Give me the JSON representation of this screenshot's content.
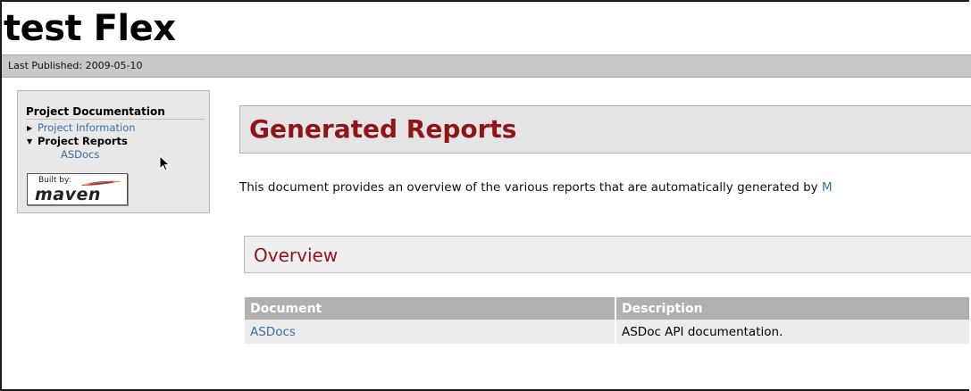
{
  "header": {
    "site_title": "test Flex",
    "last_published": "Last Published: 2009-05-10"
  },
  "sidebar": {
    "heading": "Project Documentation",
    "items": [
      {
        "label": "Project Information",
        "expanded": false
      },
      {
        "label": "Project Reports",
        "expanded": true
      },
      {
        "label": "ASDocs"
      }
    ],
    "badge": {
      "built_by": "Built by:",
      "name": "maven"
    }
  },
  "main": {
    "title": "Generated Reports",
    "intro": "This document provides an overview of the various reports that are automatically generated by",
    "intro_cut_link": "M",
    "section_title": "Overview",
    "table": {
      "headers": [
        "Document",
        "Description"
      ],
      "rows": [
        {
          "document": "ASDocs",
          "description": "ASDoc API documentation."
        }
      ]
    }
  },
  "colors": {
    "heading_red": "#8f1519",
    "link_blue": "#3a6ea8",
    "table_header_bg": "#b0b0b0"
  }
}
